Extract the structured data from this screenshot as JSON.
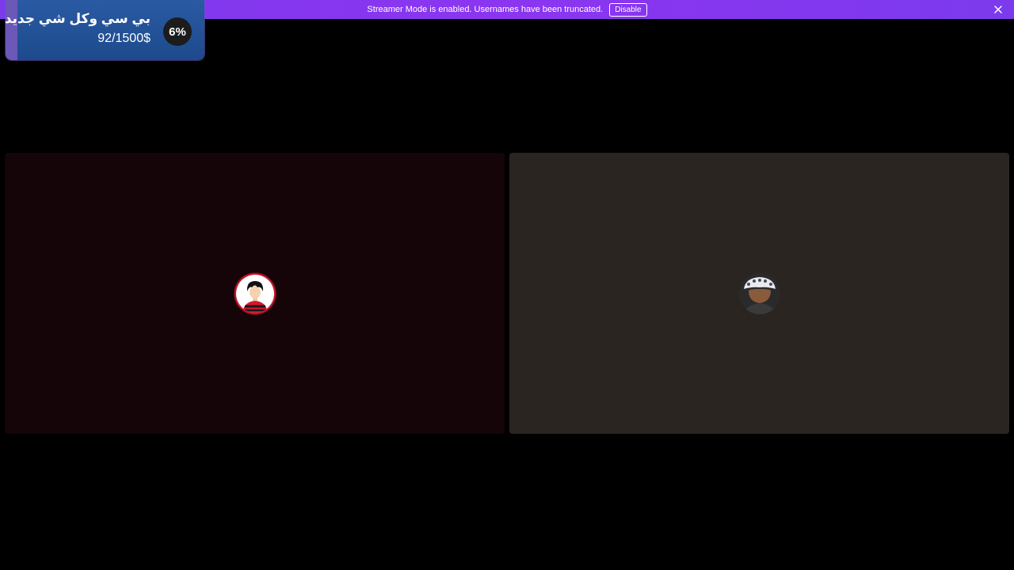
{
  "notice": {
    "text": "Streamer Mode is enabled. Usernames have been truncated.",
    "disable_label": "Disable"
  },
  "goal": {
    "title": "بي سي وكل شي جديد",
    "amount": "92/1500$",
    "percent_label": "6%",
    "progress": 0.06
  },
  "participants": [
    {
      "avatar": "red-black-cartoon-avatar-icon",
      "ring_color": "#c5162e"
    },
    {
      "avatar": "white-hat-character-avatar-icon",
      "ring_color": "#2b2522"
    }
  ],
  "colors": {
    "notice_bg": "#7c3aed",
    "goal_bg": "#1d4a8c",
    "goal_fill": "#6b58b8",
    "tile_left_bg": "#150508",
    "tile_right_bg": "#2b2522",
    "speaking_ring": "#c5162e"
  }
}
